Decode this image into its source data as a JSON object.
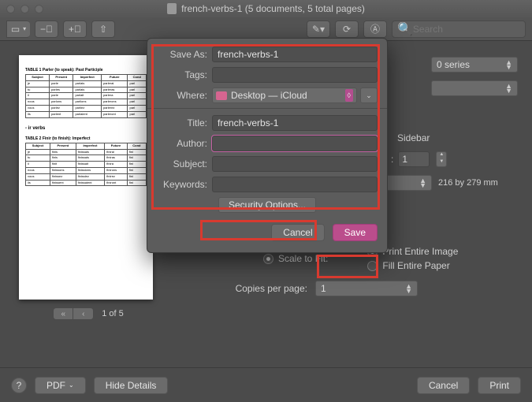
{
  "window": {
    "title": "french-verbs-1 (5 documents, 5 total pages)",
    "search_placeholder": "Search"
  },
  "preview": {
    "pager": "1 of 5",
    "table1_title": "TABLE 1 Parler (to speak): Past Participle",
    "table2_title": "TABLE 2 Finir (to finish): Imperfect",
    "section": "- ir verbs",
    "thead": [
      "Subject",
      "Present",
      "Imperfect",
      "Future",
      "Cond"
    ],
    "rows1": [
      [
        "je",
        "parle",
        "parlais",
        "parlerai",
        "parl"
      ],
      [
        "tu",
        "parles",
        "parlais",
        "parleras",
        "parl"
      ],
      [
        "il",
        "parle",
        "parlait",
        "parlera",
        "parl"
      ],
      [
        "nous",
        "parlons",
        "parlions",
        "parlerons",
        "parl"
      ],
      [
        "vous",
        "parlez",
        "parliez",
        "parlerez",
        "parl"
      ],
      [
        "ils",
        "parlent",
        "parlaient",
        "parleront",
        "parl"
      ]
    ],
    "rows2": [
      [
        "je",
        "finis",
        "finissais",
        "finirai",
        "fini"
      ],
      [
        "tu",
        "finis",
        "finissais",
        "finiras",
        "fini"
      ],
      [
        "il",
        "finit",
        "finissait",
        "finira",
        "fini"
      ],
      [
        "nous",
        "finissons",
        "finissions",
        "finirons",
        "fini"
      ],
      [
        "vous",
        "finissez",
        "finissiez",
        "finirez",
        "fini"
      ],
      [
        "ils",
        "finissent",
        "finissaient",
        "finiront",
        "fini"
      ]
    ]
  },
  "dialog": {
    "save_as_label": "Save As:",
    "save_as_value": "french-verbs-1",
    "tags_label": "Tags:",
    "tags_value": "",
    "where_label": "Where:",
    "where_value": "Desktop — iCloud",
    "title_label": "Title:",
    "title_value": "french-verbs-1",
    "author_label": "Author:",
    "author_value": "",
    "subject_label": "Subject:",
    "subject_value": "",
    "keywords_label": "Keywords:",
    "keywords_value": "",
    "security_options": "Security Options...",
    "cancel": "Cancel",
    "save": "Save"
  },
  "options": {
    "series_value": "0 series",
    "sidebar_suffix": "Sidebar",
    "sidebar_colon": ":",
    "sidebar_count": "1",
    "dimensions": "216 by 279 mm",
    "scale_label": "Scale to Fit:",
    "print_entire_image": "Print Entire Image",
    "fill_entire_paper": "Fill Entire Paper",
    "copies_label": "Copies per page:",
    "copies_value": "1"
  },
  "footer": {
    "help": "?",
    "pdf": "PDF",
    "hide_details": "Hide Details",
    "cancel": "Cancel",
    "print": "Print"
  }
}
